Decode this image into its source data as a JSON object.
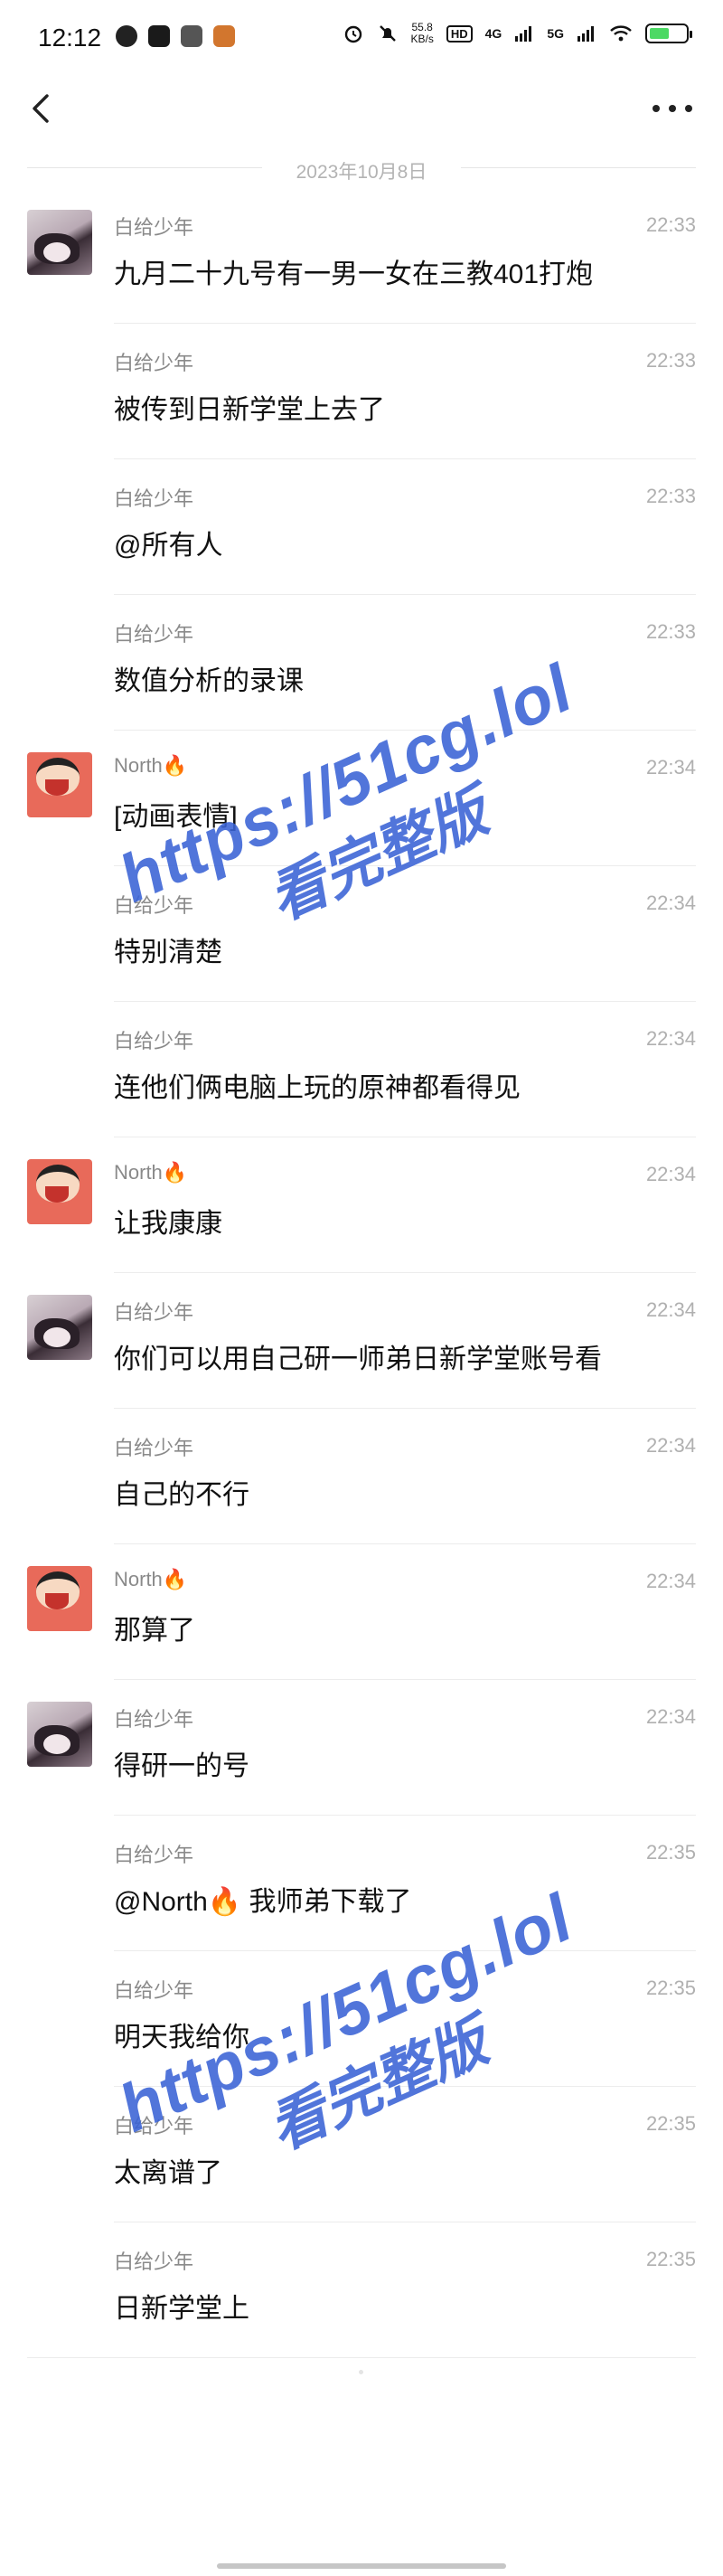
{
  "status_bar": {
    "time": "12:12",
    "net_speed_value": "55.8",
    "net_speed_unit": "KB/s",
    "hd_badge": "HD",
    "sim1_type": "4G",
    "sim2_type": "5G",
    "battery_level": 0.55
  },
  "date_divider": "2023年10月8日",
  "messages": [
    {
      "sender": "白给少年",
      "time": "22:33",
      "text": "九月二十九号有一男一女在三教401打炮",
      "avatar": "bai"
    },
    {
      "sender": "白给少年",
      "time": "22:33",
      "text": "被传到日新学堂上去了",
      "avatar": ""
    },
    {
      "sender": "白给少年",
      "time": "22:33",
      "text": "@所有人",
      "avatar": ""
    },
    {
      "sender": "白给少年",
      "time": "22:33",
      "text": "数值分析的录课",
      "avatar": ""
    },
    {
      "sender": "North🔥",
      "time": "22:34",
      "text": "[动画表情]",
      "avatar": "north"
    },
    {
      "sender": "白给少年",
      "time": "22:34",
      "text": "特别清楚",
      "avatar": ""
    },
    {
      "sender": "白给少年",
      "time": "22:34",
      "text": "连他们俩电脑上玩的原神都看得见",
      "avatar": ""
    },
    {
      "sender": "North🔥",
      "time": "22:34",
      "text": "让我康康",
      "avatar": "north"
    },
    {
      "sender": "白给少年",
      "time": "22:34",
      "text": "你们可以用自己研一师弟日新学堂账号看",
      "avatar": "bai"
    },
    {
      "sender": "白给少年",
      "time": "22:34",
      "text": "自己的不行",
      "avatar": ""
    },
    {
      "sender": "North🔥",
      "time": "22:34",
      "text": "那算了",
      "avatar": "north"
    },
    {
      "sender": "白给少年",
      "time": "22:34",
      "text": "得研一的号",
      "avatar": "bai"
    },
    {
      "sender": "白给少年",
      "time": "22:35",
      "text": "@North🔥 我师弟下载了",
      "avatar": ""
    },
    {
      "sender": "白给少年",
      "time": "22:35",
      "text": "明天我给你",
      "avatar": ""
    },
    {
      "sender": "白给少年",
      "time": "22:35",
      "text": "太离谱了",
      "avatar": ""
    },
    {
      "sender": "白给少年",
      "time": "22:35",
      "text": "日新学堂上",
      "avatar": ""
    }
  ],
  "watermark": {
    "url": "https://51cg.lol",
    "subtitle": "看完整版"
  },
  "colors": {
    "watermark": "#3a63d6",
    "north_avatar": "#e86a5a",
    "battery": "#4cd964"
  }
}
